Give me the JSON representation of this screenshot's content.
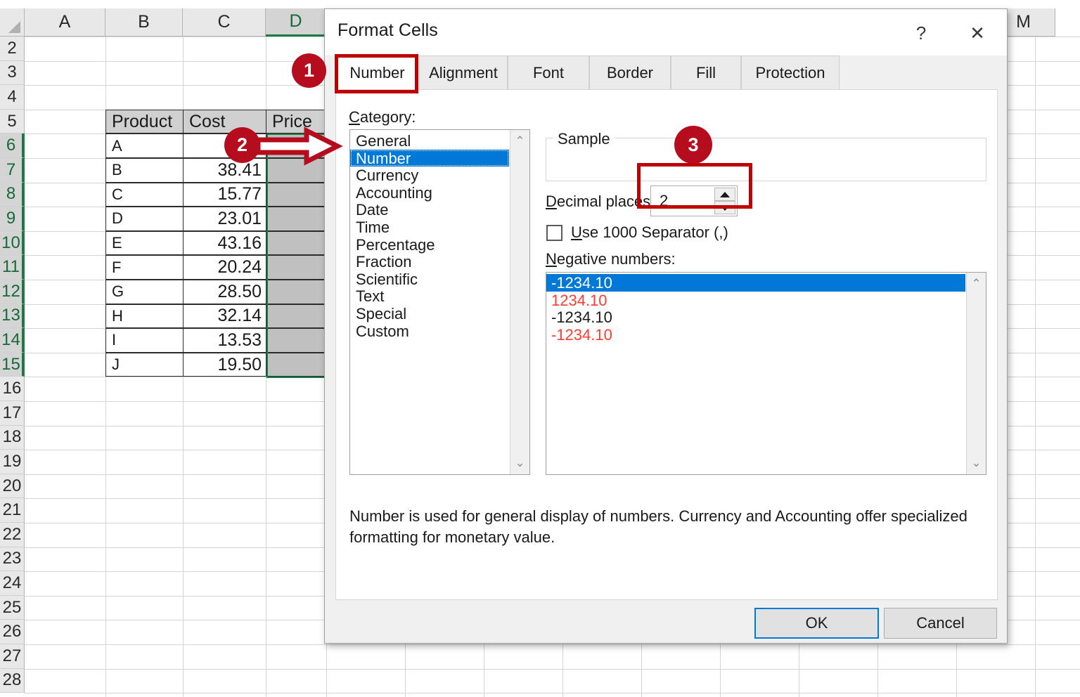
{
  "spreadsheet": {
    "column_headers": [
      "A",
      "B",
      "C",
      "D",
      "M"
    ],
    "row_headers": [
      "2",
      "3",
      "4",
      "5",
      "6",
      "7",
      "8",
      "9",
      "10",
      "11",
      "12",
      "13",
      "14",
      "15",
      "16",
      "17",
      "18",
      "19",
      "20",
      "21",
      "22",
      "23",
      "24",
      "25",
      "26",
      "27",
      "28"
    ],
    "table": {
      "headers": [
        "Product",
        "Cost",
        "Price"
      ],
      "rows": [
        {
          "product": "A",
          "cost": "",
          "price": ""
        },
        {
          "product": "B",
          "cost": "38.41",
          "price": ""
        },
        {
          "product": "C",
          "cost": "15.77",
          "price": ""
        },
        {
          "product": "D",
          "cost": "23.01",
          "price": ""
        },
        {
          "product": "E",
          "cost": "43.16",
          "price": ""
        },
        {
          "product": "F",
          "cost": "20.24",
          "price": ""
        },
        {
          "product": "G",
          "cost": "28.50",
          "price": ""
        },
        {
          "product": "H",
          "cost": "32.14",
          "price": ""
        },
        {
          "product": "I",
          "cost": "13.53",
          "price": ""
        },
        {
          "product": "J",
          "cost": "19.50",
          "price": ""
        }
      ]
    }
  },
  "dialog": {
    "title": "Format Cells",
    "help_glyph": "?",
    "close_glyph": "✕",
    "tabs": [
      {
        "label": "Number",
        "active": true
      },
      {
        "label": "Alignment",
        "active": false
      },
      {
        "label": "Font",
        "active": false
      },
      {
        "label": "Border",
        "active": false
      },
      {
        "label": "Fill",
        "active": false
      },
      {
        "label": "Protection",
        "active": false
      }
    ],
    "category": {
      "label": "Category:",
      "label_prefix": "C",
      "label_rest": "ategory:",
      "items": [
        "General",
        "Number",
        "Currency",
        "Accounting",
        "Date",
        "Time",
        "Percentage",
        "Fraction",
        "Scientific",
        "Text",
        "Special",
        "Custom"
      ],
      "selected": "Number",
      "scroll_up_glyph": "⌃",
      "scroll_down_glyph": "⌄"
    },
    "sample": {
      "legend": "Sample",
      "value": ""
    },
    "decimal_places": {
      "label_prefix": "D",
      "label_rest": "ecimal places:",
      "value": "2"
    },
    "thousands_separator": {
      "label_prefix": "U",
      "label_rest": "se 1000 Separator (,)",
      "checked": false
    },
    "negative_numbers": {
      "label_prefix": "N",
      "label_rest": "egative numbers:",
      "items": [
        {
          "text": "-1234.10",
          "color": "black",
          "selected": true
        },
        {
          "text": "1234.10",
          "color": "red",
          "selected": false
        },
        {
          "text": "-1234.10",
          "color": "black",
          "selected": false
        },
        {
          "text": "-1234.10",
          "color": "red",
          "selected": false
        }
      ],
      "scroll_up_glyph": "⌃",
      "scroll_down_glyph": "⌄"
    },
    "description": "Number is used for general display of numbers.  Currency and Accounting offer specialized formatting for monetary value.",
    "buttons": {
      "ok": "OK",
      "cancel": "Cancel"
    }
  },
  "annotations": {
    "badges": [
      {
        "number": "1"
      },
      {
        "number": "2"
      },
      {
        "number": "3"
      }
    ],
    "accent_color": "#b50d1e",
    "highlight_box_color": "#c00000"
  }
}
